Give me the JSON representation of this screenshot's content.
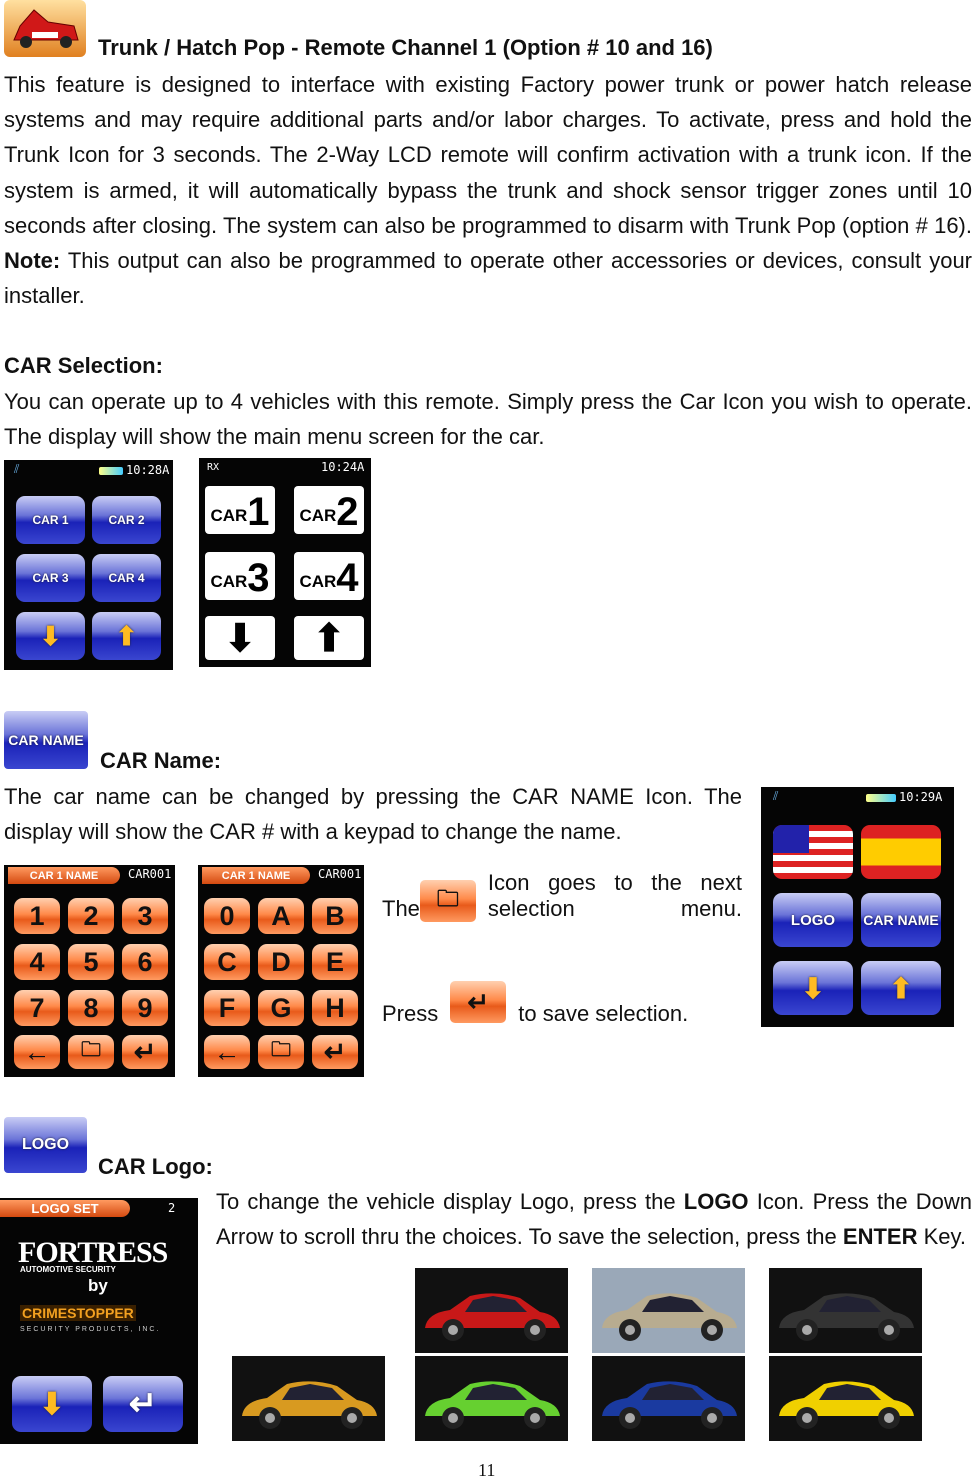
{
  "trunk": {
    "icon": "trunk-pop-car-icon",
    "title": "Trunk / Hatch Pop - Remote Channel 1 (Option # 10 and 16)",
    "body_pre": "This feature is designed to interface with existing Factory power trunk or power hatch release systems and may require additional parts and/or labor charges. To activate, press and hold the Trunk Icon for 3 seconds. The 2-Way LCD remote will confirm activation with a trunk icon. If the system is armed, it will automatically bypass the trunk and shock sensor trigger zones until 10 seconds after closing. The system can also be programmed to disarm with Trunk Pop (option # 16). ",
    "note_label": "Note:",
    "body_post": " This output can also be programmed to operate other accessories or devices, consult your installer."
  },
  "car_selection": {
    "heading": "CAR Selection:",
    "body": "You can operate up to 4 vehicles with this remote. Simply press the Car Icon you wish to operate. The display will show the main menu screen for the car.",
    "screen_color": {
      "time": "10:28A",
      "buttons": [
        "CAR 1",
        "CAR 2",
        "CAR 3",
        "CAR 4"
      ]
    },
    "screen_mono": {
      "status": "RX",
      "time": "10:24A",
      "car_label": "CAR",
      "numbers": [
        "1",
        "2",
        "3",
        "4"
      ]
    }
  },
  "car_name": {
    "icon_label": "CAR NAME",
    "heading": "CAR Name:",
    "body": "The car name can be changed by pressing the CAR NAME Icon. The display will show the CAR # with a keypad to change the name.",
    "keypad_title": "CAR 1 NAME",
    "keypad_value": "CAR001",
    "keypad_numeric": [
      "1",
      "2",
      "3",
      "4",
      "5",
      "6",
      "7",
      "8",
      "9"
    ],
    "keypad_alpha": [
      "0",
      "A",
      "B",
      "C",
      "D",
      "E",
      "F",
      "G",
      "H"
    ],
    "next_pre": "The",
    "next_post": "Icon goes to the next selection menu.",
    "save_pre": "Press",
    "save_post": "to save selection.",
    "menu_screen": {
      "time": "10:29A",
      "logo_label": "LOGO",
      "carname_label": "CAR NAME"
    }
  },
  "car_logo": {
    "icon_label": "LOGO",
    "heading": "CAR Logo:",
    "body_1": "To change the vehicle display Logo, press the ",
    "logo_word": "LOGO",
    "body_2": " Icon. Press the Down Arrow to scroll thru the choices. To save the selection, press the ",
    "enter_word": "ENTER",
    "body_3": " Key.",
    "screen": {
      "title": "LOGO SET",
      "number": "2",
      "brand": "FORTRESS",
      "brand_sub": "AUTOMOTIVE SECURITY",
      "by": "by",
      "maker": "CRIMESTOPPER",
      "maker_sub": "SECURITY PRODUCTS, INC."
    },
    "car_images": [
      {
        "color": "#c81818",
        "bg": "#111"
      },
      {
        "color": "#b8ac90",
        "bg": "#9aa8b8"
      },
      {
        "color": "#333",
        "bg": "#111"
      },
      {
        "color": "#d89a20",
        "bg": "#111"
      },
      {
        "color": "#66d030",
        "bg": "#111"
      },
      {
        "color": "#1a3aa0",
        "bg": "#111"
      },
      {
        "color": "#f0d000",
        "bg": "#111"
      }
    ]
  },
  "page_number": "11"
}
